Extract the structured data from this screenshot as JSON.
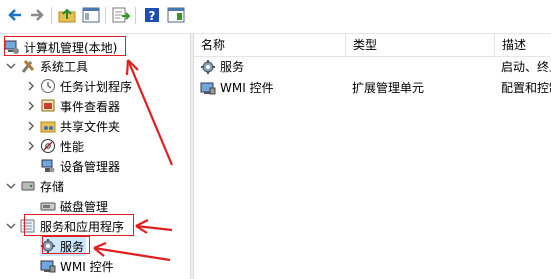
{
  "toolbar": {
    "buttons": [
      {
        "icon": "back-arrow-icon"
      },
      {
        "icon": "forward-arrow-icon"
      },
      {
        "icon": "up-folder-icon"
      },
      {
        "icon": "show-hide-console-tree-icon"
      },
      {
        "icon": "export-list-icon"
      },
      {
        "icon": "help-icon"
      },
      {
        "icon": "action-pane-icon"
      }
    ]
  },
  "tree": {
    "root": "计算机管理(本地)",
    "system_tools": "系统工具",
    "task_scheduler": "任务计划程序",
    "event_viewer": "事件查看器",
    "shared_folders": "共享文件夹",
    "performance": "性能",
    "device_manager": "设备管理器",
    "storage": "存储",
    "disk_management": "磁盘管理",
    "services_apps": "服务和应用程序",
    "services": "服务",
    "wmi": "WMI 控件"
  },
  "list": {
    "columns": [
      "名称",
      "类型",
      "描述"
    ],
    "rows": [
      {
        "name": "服务",
        "type": "",
        "desc": "启动、终止"
      },
      {
        "name": "WMI 控件",
        "type": "扩展管理单元",
        "desc": "配置和控制"
      }
    ]
  },
  "colors": {
    "annotation": "#e02020",
    "selection": "#cce8ff"
  }
}
